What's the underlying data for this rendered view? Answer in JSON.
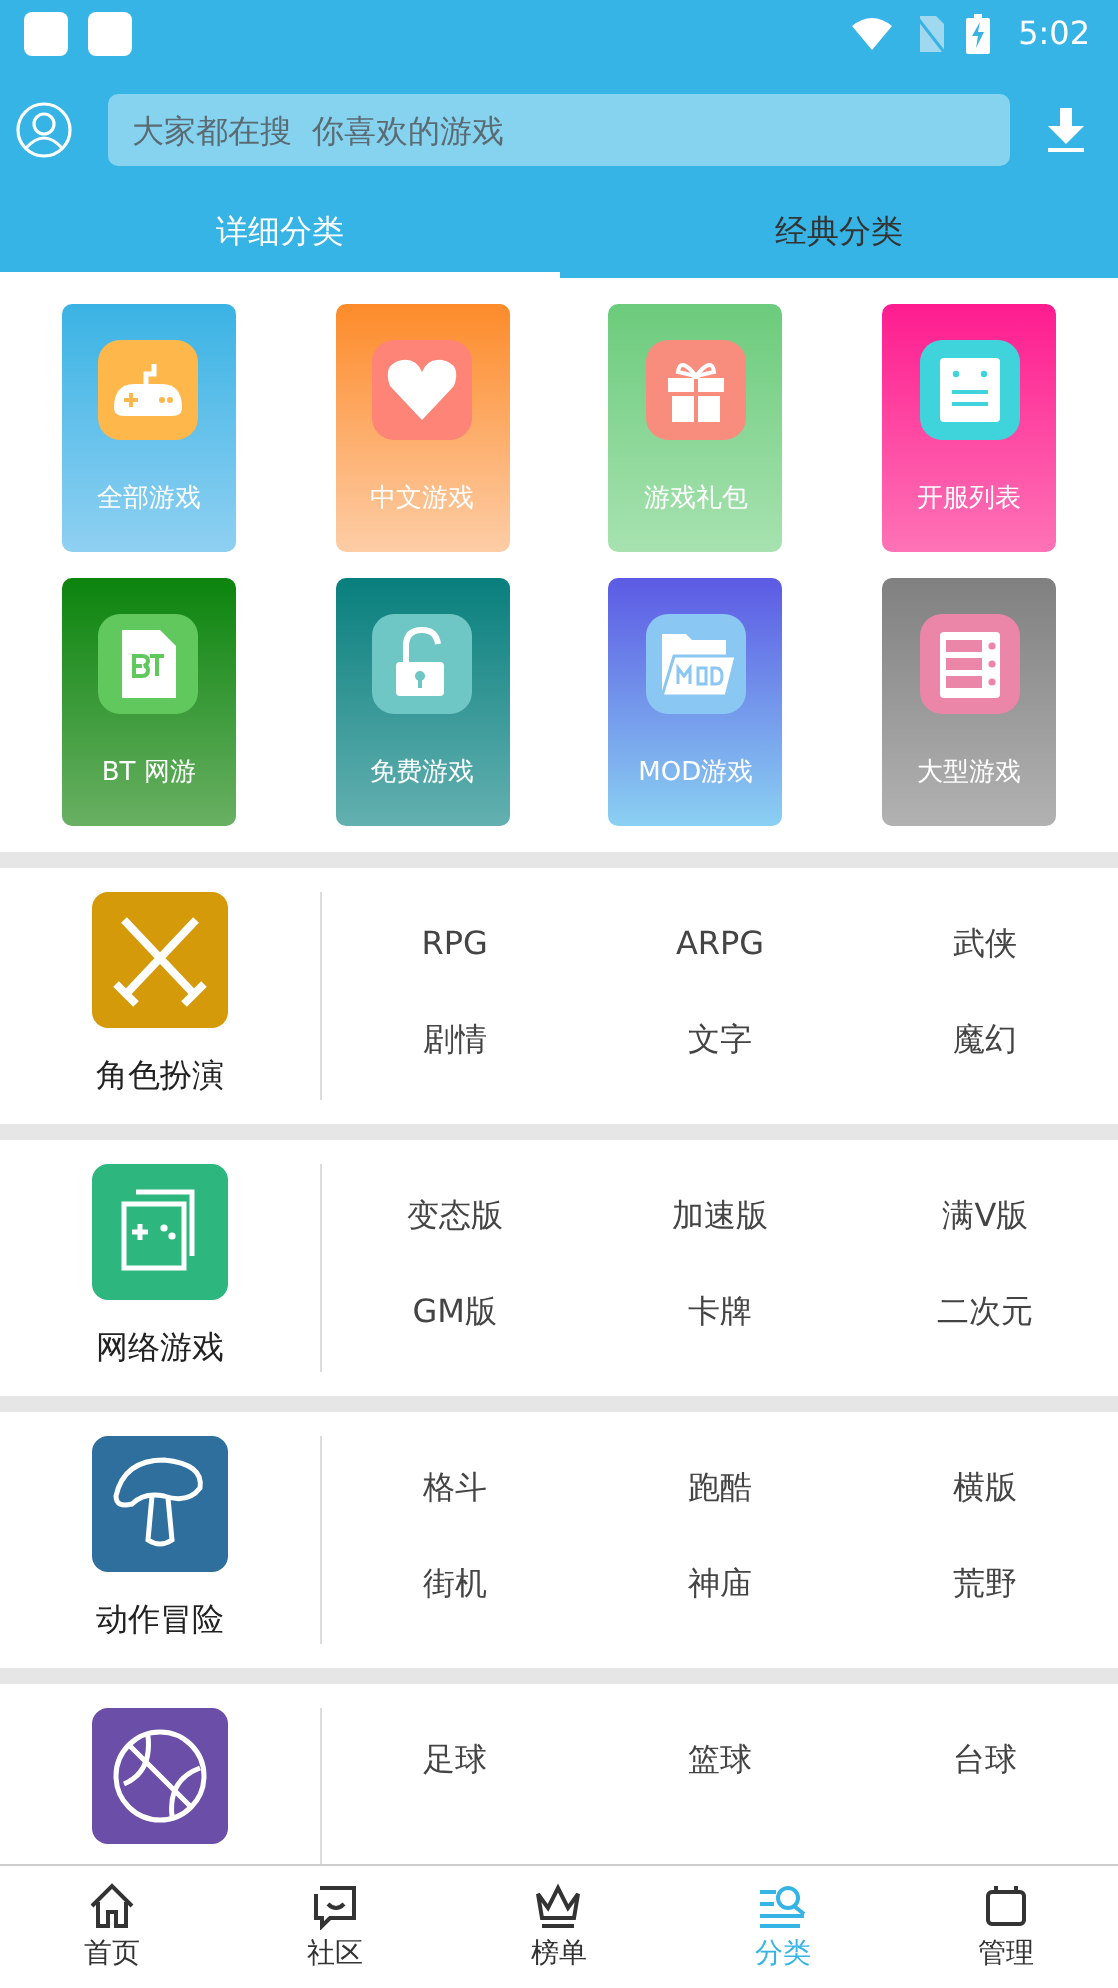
{
  "status_bar": {
    "time": "5:02"
  },
  "search": {
    "placeholder": "大家都在搜  你喜欢的游戏"
  },
  "tabs": [
    {
      "label": "详细分类",
      "selected": true
    },
    {
      "label": "经典分类",
      "selected": false
    }
  ],
  "quick_links": [
    {
      "label": "全部游戏",
      "kind": "gamepad"
    },
    {
      "label": "中文游戏",
      "kind": "heart"
    },
    {
      "label": "游戏礼包",
      "kind": "gift"
    },
    {
      "label": "开服列表",
      "kind": "list"
    },
    {
      "label": "BT 网游",
      "kind": "bt"
    },
    {
      "label": "免费游戏",
      "kind": "unlock"
    },
    {
      "label": "MOD游戏",
      "kind": "mod"
    },
    {
      "label": "大型游戏",
      "kind": "server"
    }
  ],
  "sections": [
    {
      "title": "角色扮演",
      "kind": "swords",
      "tags": [
        "RPG",
        "ARPG",
        "武侠",
        "剧情",
        "文字",
        "魔幻"
      ]
    },
    {
      "title": "网络游戏",
      "kind": "network",
      "tags": [
        "变态版",
        "加速版",
        "满V版",
        "GM版",
        "卡牌",
        "二次元"
      ]
    },
    {
      "title": "动作冒险",
      "kind": "mushroom",
      "tags": [
        "格斗",
        "跑酷",
        "横版",
        "街机",
        "神庙",
        "荒野"
      ]
    },
    {
      "kind": "ball",
      "tags": [
        "足球",
        "篮球",
        "台球"
      ]
    }
  ],
  "bottom_nav": [
    {
      "label": "首页",
      "kind": "home",
      "selected": false
    },
    {
      "label": "社区",
      "kind": "chat",
      "selected": false
    },
    {
      "label": "榜单",
      "kind": "crown",
      "selected": false
    },
    {
      "label": "分类",
      "kind": "category",
      "selected": true
    },
    {
      "label": "管理",
      "kind": "manage",
      "selected": false
    }
  ]
}
